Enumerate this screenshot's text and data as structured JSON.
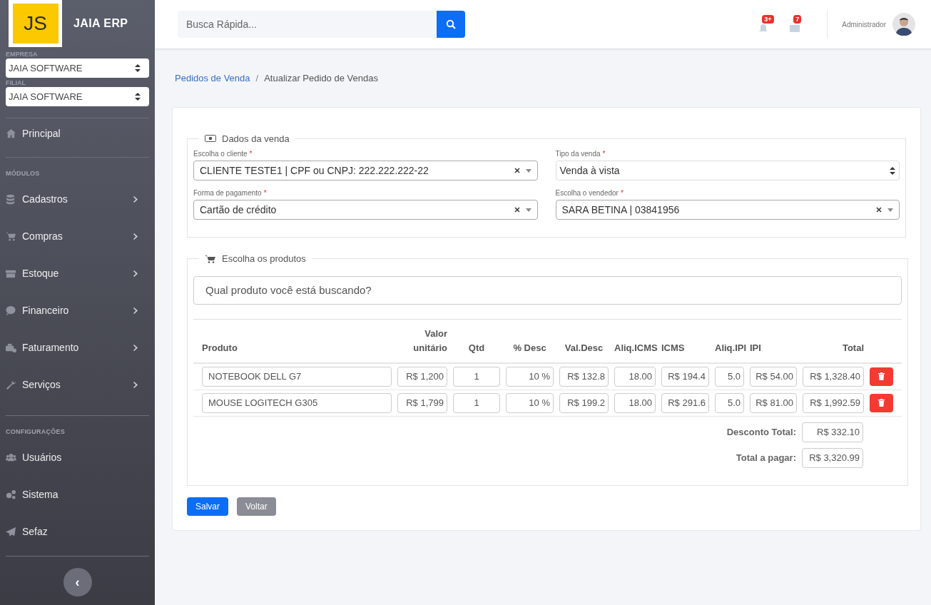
{
  "brand": {
    "logo": "JS",
    "name": "JAIA ERP"
  },
  "company_selects": [
    {
      "label": "EMPRESA",
      "value": "JAIA SOFTWARE"
    },
    {
      "label": "FILIAL",
      "value": "JAIA SOFTWARE"
    }
  ],
  "nav_groups": [
    {
      "items": [
        {
          "label": "Principal",
          "has_submenu": false
        }
      ]
    },
    {
      "heading": "MÓDULOS",
      "items": [
        {
          "label": "Cadastros",
          "has_submenu": true
        },
        {
          "label": "Compras",
          "has_submenu": true
        },
        {
          "label": "Estoque",
          "has_submenu": true
        },
        {
          "label": "Financeiro",
          "has_submenu": true
        },
        {
          "label": "Faturamento",
          "has_submenu": true
        },
        {
          "label": "Serviços",
          "has_submenu": true
        }
      ]
    },
    {
      "heading": "CONFIGURAÇÕES",
      "items": [
        {
          "label": "Usuários",
          "has_submenu": false
        },
        {
          "label": "Sistema",
          "has_submenu": false
        },
        {
          "label": "Sefaz",
          "has_submenu": false
        }
      ]
    }
  ],
  "collapse_button": "‹",
  "search": {
    "placeholder": "Busca Rápida..."
  },
  "notifications": {
    "count": "3+"
  },
  "messages": {
    "count": "7"
  },
  "user": {
    "name": "Administrador"
  },
  "breadcrumb": {
    "separator": "/",
    "items": [
      {
        "label": "Pedidos de Venda",
        "kind": "link"
      },
      {
        "label": "Atualizar Pedido de Vendas",
        "kind": "current"
      }
    ]
  },
  "sale_section": {
    "title": "Dados da venda",
    "fields": [
      {
        "label": "Escolha o cliente",
        "required_mark": "*",
        "value": "CLIENTE TESTE1 | CPF ou CNPJ: 222.222.222-22",
        "kind": "select2"
      },
      {
        "label": "Tipo da venda",
        "required_mark": "*",
        "value": "Venda à vista",
        "kind": "native"
      },
      {
        "label": "Forma de pagamento",
        "required_mark": "*",
        "value": "Cartão de crédito",
        "kind": "select2"
      },
      {
        "label": "Escolha o vendedor",
        "required_mark": "*",
        "value": "SARA BETINA | 03841956",
        "kind": "select2"
      }
    ]
  },
  "products_section": {
    "title": "Escolha os produtos",
    "search_placeholder": "Qual produto você está buscando?",
    "columns": [
      "Produto",
      "Valor unitário",
      "Qtd",
      "% Desc",
      "Val.Desc",
      "Aliq.ICMS",
      "ICMS",
      "Aliq.IPI",
      "IPI",
      "Total"
    ],
    "rows": [
      {
        "cells": [
          "NOTEBOOK DELL G7",
          "R$ 1,200",
          "1",
          "10 %",
          "R$ 132.8",
          "18.00",
          "R$ 194.4",
          "5.0",
          "R$ 54.00",
          "R$ 1,328.40"
        ]
      },
      {
        "cells": [
          "MOUSE LOGITECH G305",
          "R$ 1,799",
          "1",
          "10 %",
          "R$ 199.2",
          "18.00",
          "R$ 291.6",
          "5.0",
          "R$ 81.00",
          "R$ 1,992.59"
        ]
      }
    ],
    "totals": [
      {
        "label": "Desconto Total:",
        "value": "R$ 332.10"
      },
      {
        "label": "Total a pagar:",
        "value": "R$ 3,320.99"
      }
    ]
  },
  "buttons": [
    {
      "label": "Salvar",
      "kind": "primary"
    },
    {
      "label": "Voltar",
      "kind": "secondary"
    }
  ]
}
